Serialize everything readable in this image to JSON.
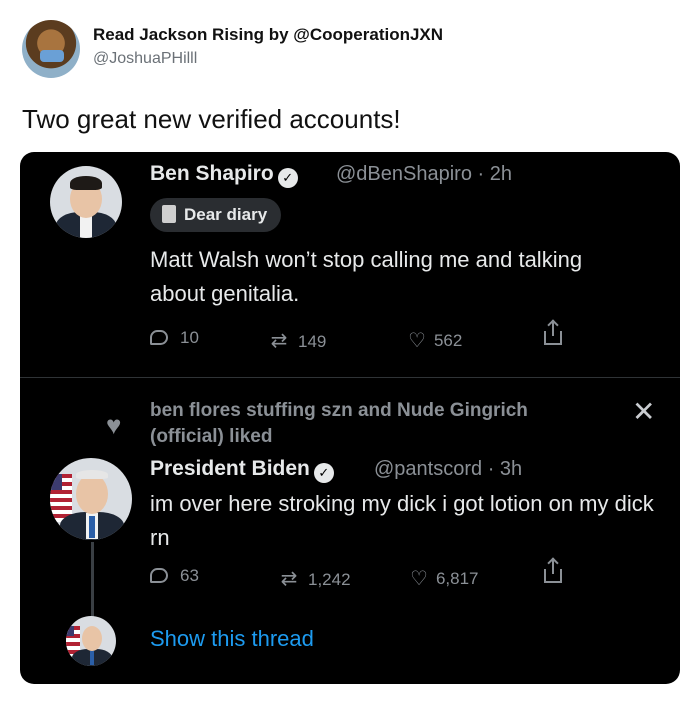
{
  "outer": {
    "name": "Read Jackson Rising by @CooperationJXN",
    "handle": "@JoshuaPHilll",
    "text": "Two great new verified accounts!"
  },
  "tweet1": {
    "name": "Ben Shapiro",
    "handle_time": "@dBenShapiro · 2h",
    "pill": "Dear diary",
    "body": "Matt Walsh won’t stop calling me and talking about genitalia.",
    "replies": "10",
    "retweets": "149",
    "likes": "562"
  },
  "liked_by": "ben flores stuffing szn and Nude Gingrich (official) liked",
  "tweet2": {
    "name": "President Biden",
    "handle_time": "@pantscord · 3h",
    "body": "im over here stroking my dick i got lotion on my dick rn",
    "replies": "63",
    "retweets": "1,242",
    "likes": "6,817"
  },
  "show_thread": "Show this thread",
  "colors": {
    "accent": "#1d9bf0",
    "card_bg": "#000000",
    "muted": "#8b9096"
  }
}
